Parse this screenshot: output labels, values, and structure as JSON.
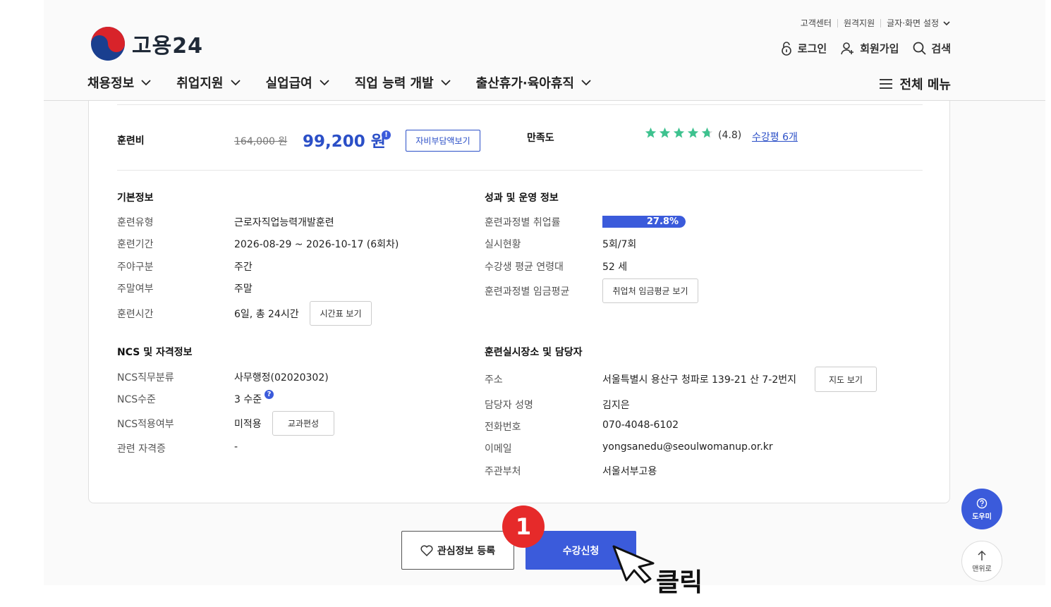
{
  "brand": {
    "logo_text": "고용24"
  },
  "utility": [
    "고객센터",
    "원격지원",
    "글자·화면 설정"
  ],
  "user_nav": {
    "login": "로그인",
    "signup": "회원가입",
    "search": "검색"
  },
  "gnb": [
    "채용정보",
    "취업지원",
    "실업급여",
    "직업 능력 개발",
    "출산휴가·육아휴직"
  ],
  "all_menu": "전체 메뉴",
  "fee": {
    "label": "훈련비",
    "original": "164,000 원",
    "price": "99,200 원",
    "selfpay_button": "자비부담액보기",
    "satisfaction_label": "만족도",
    "rating": 4.8,
    "rating_text": "(4.8)",
    "reviews_link": "수강평 6개",
    "star_color": "#3ec28f"
  },
  "basic": {
    "title": "기본정보",
    "rows": [
      {
        "label": "훈련유형",
        "value": "근로자직업능력개발훈련"
      },
      {
        "label": "훈련기간",
        "value": "2026-08-29 ~ 2026-10-17 (6회차)"
      },
      {
        "label": "주야구분",
        "value": "주간"
      },
      {
        "label": "주말여부",
        "value": "주말"
      },
      {
        "label": "훈련시간",
        "value": "6일, 총 24시간"
      }
    ],
    "timetable_button": "시간표 보기"
  },
  "performance": {
    "title": "성과 및 운영 정보",
    "employment_label": "훈련과정별 취업률",
    "employment_rate": 27.8,
    "employment_text": "27.8%",
    "status_label": "실시현황",
    "status_value": "5회/7회",
    "age_label": "수강생 평균 연령대",
    "age_value": "52 세",
    "wage_label": "훈련과정별 임금평균",
    "wage_button": "취업처 임금평균 보기"
  },
  "ncs": {
    "title": "NCS 및 자격정보",
    "class_label": "NCS직무분류",
    "class_value": "사무행정(02020302)",
    "level_label": "NCS수준",
    "level_value": "3 수준",
    "apply_label": "NCS적용여부",
    "apply_value": "미적용",
    "curriculum_button": "교과편성",
    "cert_label": "관련 자격증",
    "cert_value": "-"
  },
  "place": {
    "title": "훈련실시장소 및 담당자",
    "address_label": "주소",
    "address_value": "서울특별시 용산구 청파로 139-21 산 7-2번지",
    "map_button": "지도 보기",
    "manager_label": "담당자 성명",
    "manager_value": "김지은",
    "phone_label": "전화번호",
    "phone_value": "070-4048-6102",
    "email_label": "이메일",
    "email_value": "yongsanedu@seoulwomanup.or.kr",
    "dept_label": "주관부처",
    "dept_value": "서울서부고용"
  },
  "actions": {
    "favorite": "관심정보 등록",
    "apply": "수강신청",
    "step": "1",
    "click_hint": "클릭"
  },
  "floating": {
    "help": "도우미",
    "top": "맨위로"
  },
  "colors": {
    "primary": "#3b5bdb",
    "badge": "#e62a2a"
  }
}
